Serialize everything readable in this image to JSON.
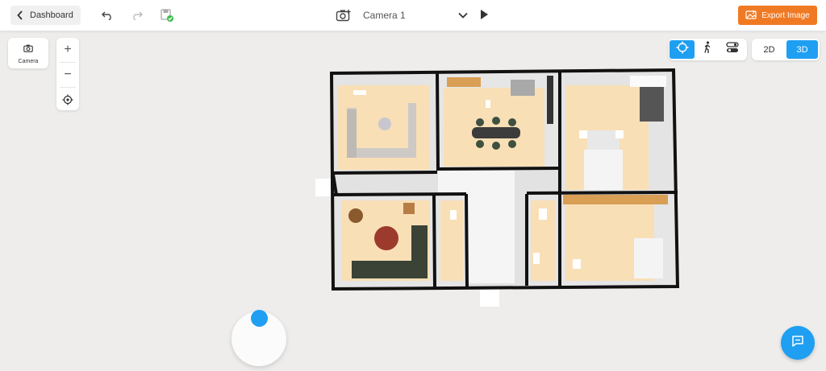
{
  "header": {
    "dashboard_label": "Dashboard",
    "camera_name": "Camera 1",
    "export_label": "Export Image"
  },
  "left_tools": {
    "camera_label": "Camera",
    "zoom_in": "+",
    "zoom_out": "−"
  },
  "view_toggle": {
    "view_2d": "2D",
    "view_3d": "3D",
    "active": "3D"
  },
  "navigation_modes": {
    "active": "orbit",
    "items": [
      "orbit",
      "walk",
      "toggle"
    ]
  },
  "colors": {
    "accent": "#1e9ff2",
    "export": "#f07a24",
    "wall": "#111111",
    "floor": "#f9dfb6",
    "corridor": "#ffffff"
  },
  "icons": {
    "back": "chevron-left-icon",
    "undo": "undo-icon",
    "redo": "redo-icon",
    "save": "save-check-icon",
    "camera_add": "camera-add-icon",
    "dropdown": "chevron-down-icon",
    "play": "play-icon",
    "export": "image-icon",
    "recenter": "crosshair-icon",
    "chat": "chat-icon"
  }
}
